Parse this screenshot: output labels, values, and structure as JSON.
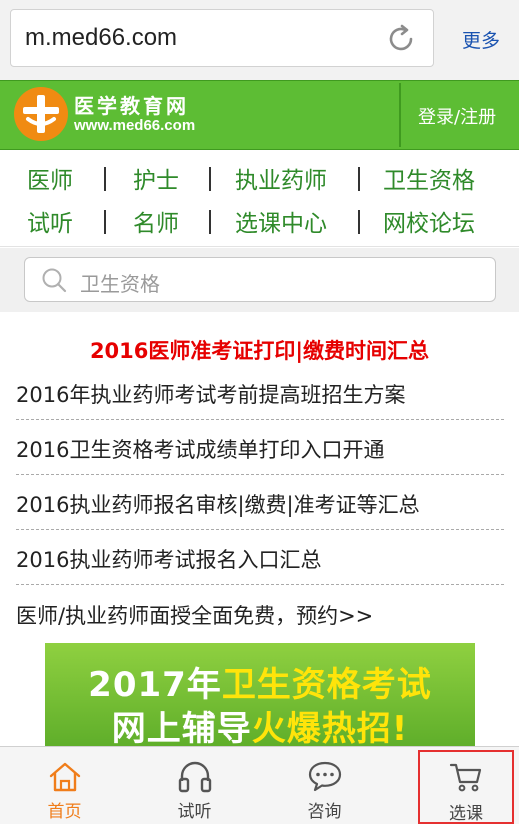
{
  "browser": {
    "url": "m.med66.com",
    "more_label": "更多"
  },
  "header": {
    "site_name": "医学教育网",
    "site_url": "www.med66.com",
    "login_label": "登录/注册"
  },
  "nav": {
    "row1": [
      "医师",
      "护士",
      "执业药师",
      "卫生资格"
    ],
    "row2": [
      "试听",
      "名师",
      "选课中心",
      "网校论坛"
    ]
  },
  "search": {
    "placeholder": "卫生资格"
  },
  "news": {
    "headline": "2016医师准考证打印|缴费时间汇总",
    "items": [
      "2016年执业药师考试考前提高班招生方案",
      "2016卫生资格考试成绩单打印入口开通",
      "2016执业药师报名审核|缴费|准考证等汇总",
      "2016执业药师考试报名入口汇总"
    ],
    "promo": "医师/执业药师面授全面免费，预约>>"
  },
  "banner": {
    "line1_white": "2017年",
    "line1_yellow": "卫生资格考试",
    "line2_white": "网上辅导",
    "line2_yellow": "火爆热招!"
  },
  "tabbar": {
    "tabs": [
      {
        "label": "首页",
        "icon": "home-icon",
        "active": true
      },
      {
        "label": "试听",
        "icon": "headphones-icon",
        "active": false
      },
      {
        "label": "咨询",
        "icon": "chat-bubble-icon",
        "active": false
      },
      {
        "label": "选课",
        "icon": "cart-icon",
        "active": false
      }
    ]
  },
  "colors": {
    "brand_green": "#5dbd34",
    "nav_green": "#2f8a2a",
    "headline_red": "#e60000",
    "active_orange": "#f07d1a",
    "highlight_red": "#e53030"
  }
}
